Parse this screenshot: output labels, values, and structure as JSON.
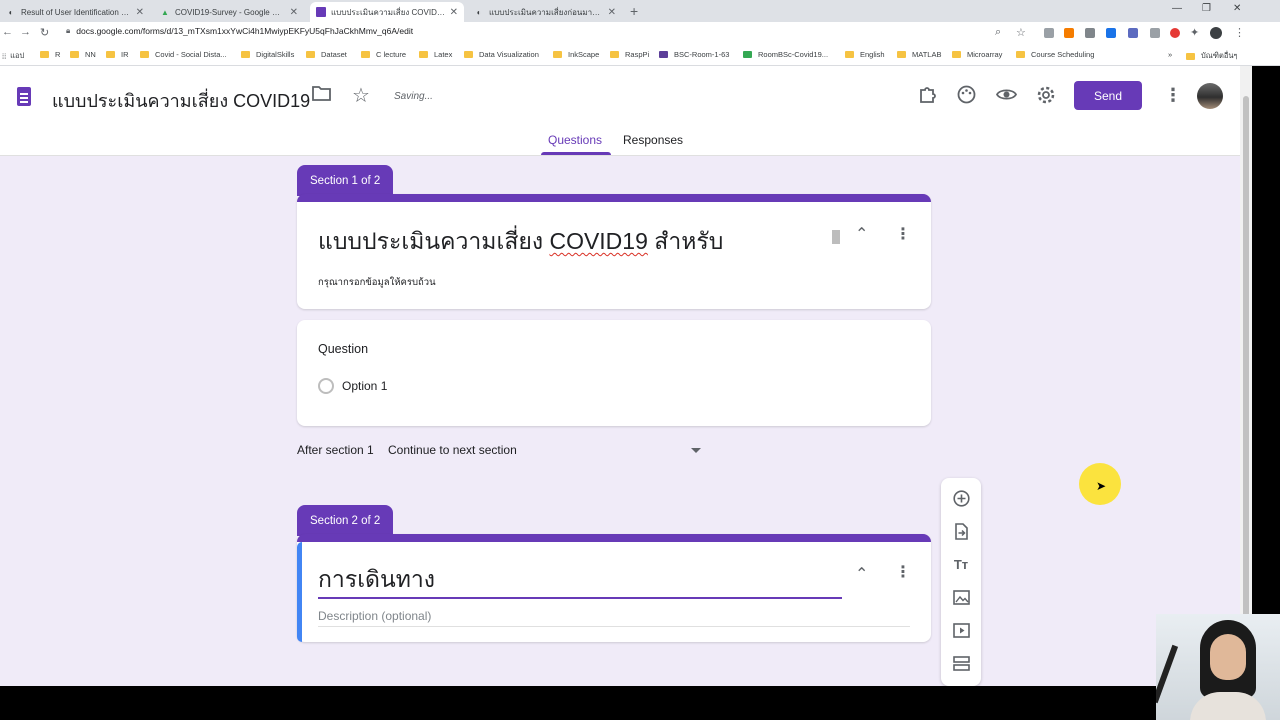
{
  "browser": {
    "tabs": [
      {
        "title": "Result of User Identification Port",
        "active": false
      },
      {
        "title": "COVID19-Survey - Google Drive",
        "active": false
      },
      {
        "title": "แบบประเมินความเสี่ยง COVID19 - Go",
        "active": true
      },
      {
        "title": "แบบประเมินความเสี่ยงก่อนมาโรงพยาบา",
        "active": false
      }
    ],
    "url": "docs.google.com/forms/d/13_mTXsm1xxYwCi4h1MwiypEKFyU5qFhJaCkhMmv_q6A/edit",
    "bookmarks": [
      "แอป",
      "R",
      "NN",
      "IR",
      "Covid - Social Dista...",
      "DigitalSkills",
      "Dataset",
      "C lecture",
      "Latex",
      "Data Visualization",
      "InkScape",
      "RaspPi",
      "BSC-Room-1-63",
      "RoomBSc-Covid19...",
      "English",
      "MATLAB",
      "Microarray",
      "Course Scheduling",
      "บัณฑิตอื่นๆ"
    ]
  },
  "form": {
    "title": "แบบประเมินความเสี่ยง COVID19",
    "status": "Saving...",
    "send_label": "Send",
    "tabs": {
      "questions": "Questions",
      "responses": "Responses"
    }
  },
  "section1": {
    "label": "Section 1 of 2",
    "title_prefix": "แบบประเมินความเสี่ยง ",
    "title_underlined": "COVID19",
    "title_suffix": " สำหรับ",
    "description": "กรุณากรอกข้อมูลให้ครบถ้วน",
    "question": {
      "title": "Question",
      "option": "Option 1"
    },
    "after_label": "After section 1",
    "after_value": "Continue to next section"
  },
  "section2": {
    "label": "Section 2 of 2",
    "title": "การเดินทาง",
    "description_placeholder": "Description (optional)"
  },
  "colors": {
    "accent": "#673ab7",
    "background": "#f0ebf8",
    "focus": "#4285f4"
  }
}
